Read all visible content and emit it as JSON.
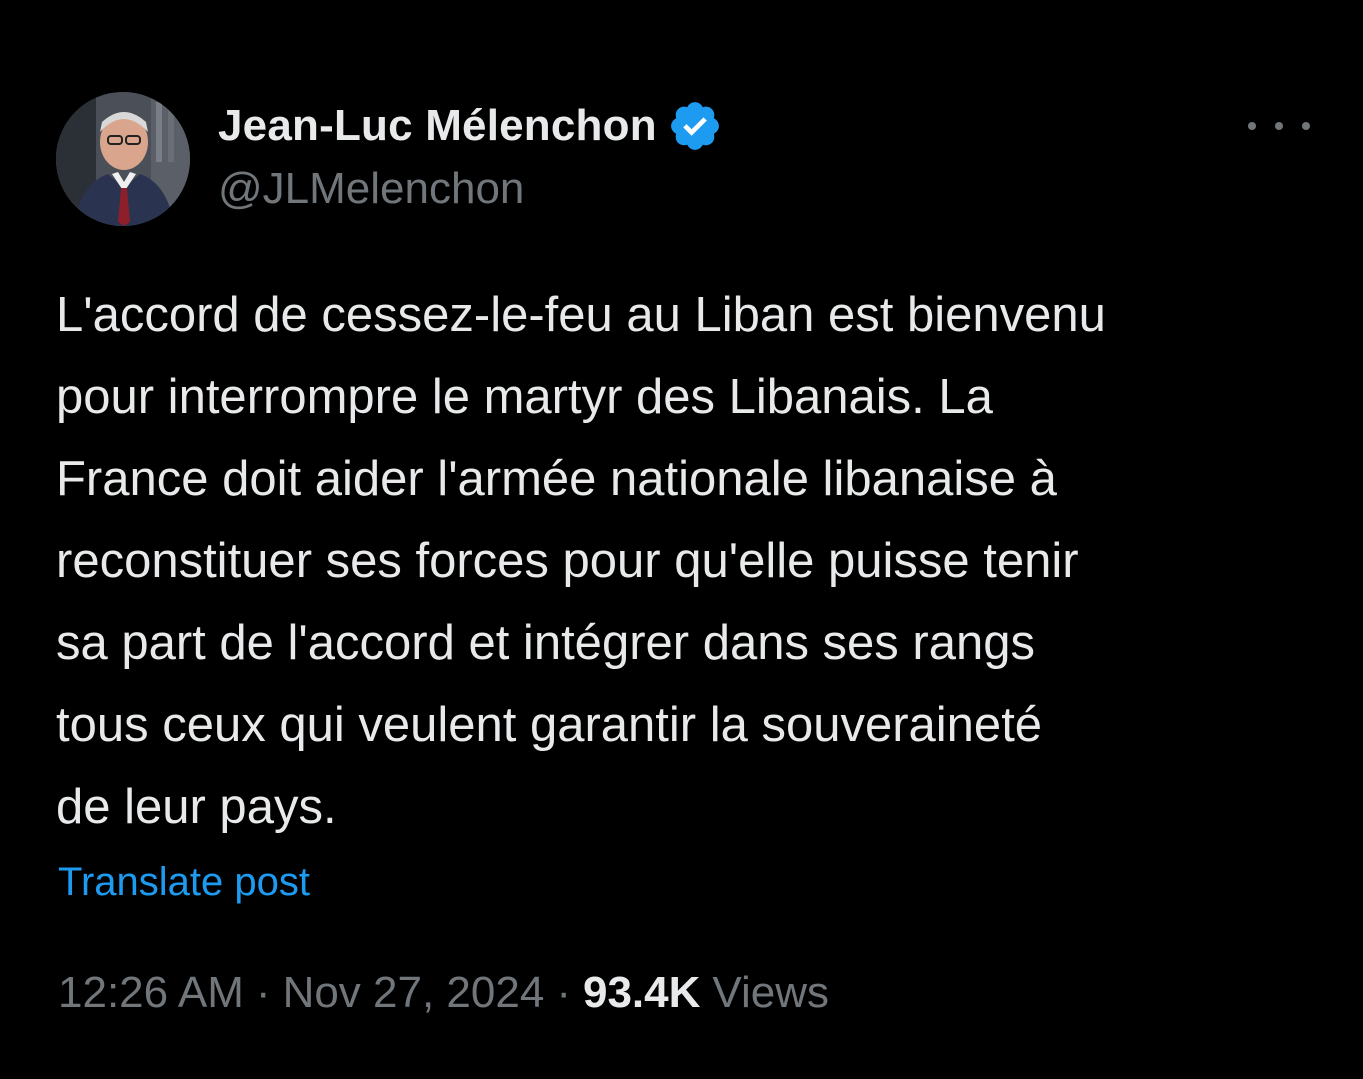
{
  "author": {
    "display_name": "Jean-Luc Mélenchon",
    "handle": "@JLMelenchon",
    "verified": true,
    "avatar_icon": "profile-photo"
  },
  "tweet": {
    "text": "L'accord de cessez-le-feu au Liban est bienvenu\npour interrompre le martyr des Libanais. La\nFrance doit aider l'armée nationale libanaise à\nreconstituer ses forces pour qu'elle puisse tenir\nsa part de l'accord et intégrer dans ses rangs\ntous ceux qui veulent garantir la souveraineté\nde leur pays.",
    "translate_label": "Translate post"
  },
  "meta": {
    "time": "12:26 AM",
    "separator": "·",
    "date": "Nov 27, 2024",
    "views_count": "93.4K",
    "views_label": "Views"
  },
  "colors": {
    "background": "#000000",
    "primary_text": "#e7e9ea",
    "secondary_text": "#71767b",
    "link": "#1d9bf0",
    "verified_badge": "#1d9bf0"
  },
  "icons": {
    "verified": "verified-badge-icon",
    "more": "more-options-icon"
  }
}
